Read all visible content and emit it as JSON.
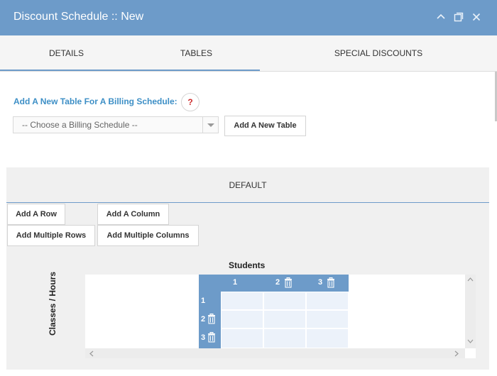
{
  "window": {
    "title": "Discount Schedule :: New"
  },
  "tabs": [
    {
      "label": "DETAILS"
    },
    {
      "label": "TABLES"
    },
    {
      "label": "SPECIAL DISCOUNTS"
    }
  ],
  "billing": {
    "label": "Add A New Table For A Billing Schedule:",
    "help": "?",
    "select_value": "-- Choose a Billing Schedule --",
    "add_table_label": "Add A New Table"
  },
  "table_panel": {
    "tab_label": "DEFAULT",
    "add_row_label": "Add A Row",
    "add_column_label": "Add A Column",
    "add_multiple_rows_label": "Add Multiple Rows",
    "add_multiple_columns_label": "Add Multiple Columns"
  },
  "grid": {
    "column_axis_title": "Students",
    "row_axis_title": "Classes / Hours",
    "columns": [
      "1",
      "2",
      "3"
    ],
    "rows": [
      "1",
      "2",
      "3"
    ]
  }
}
